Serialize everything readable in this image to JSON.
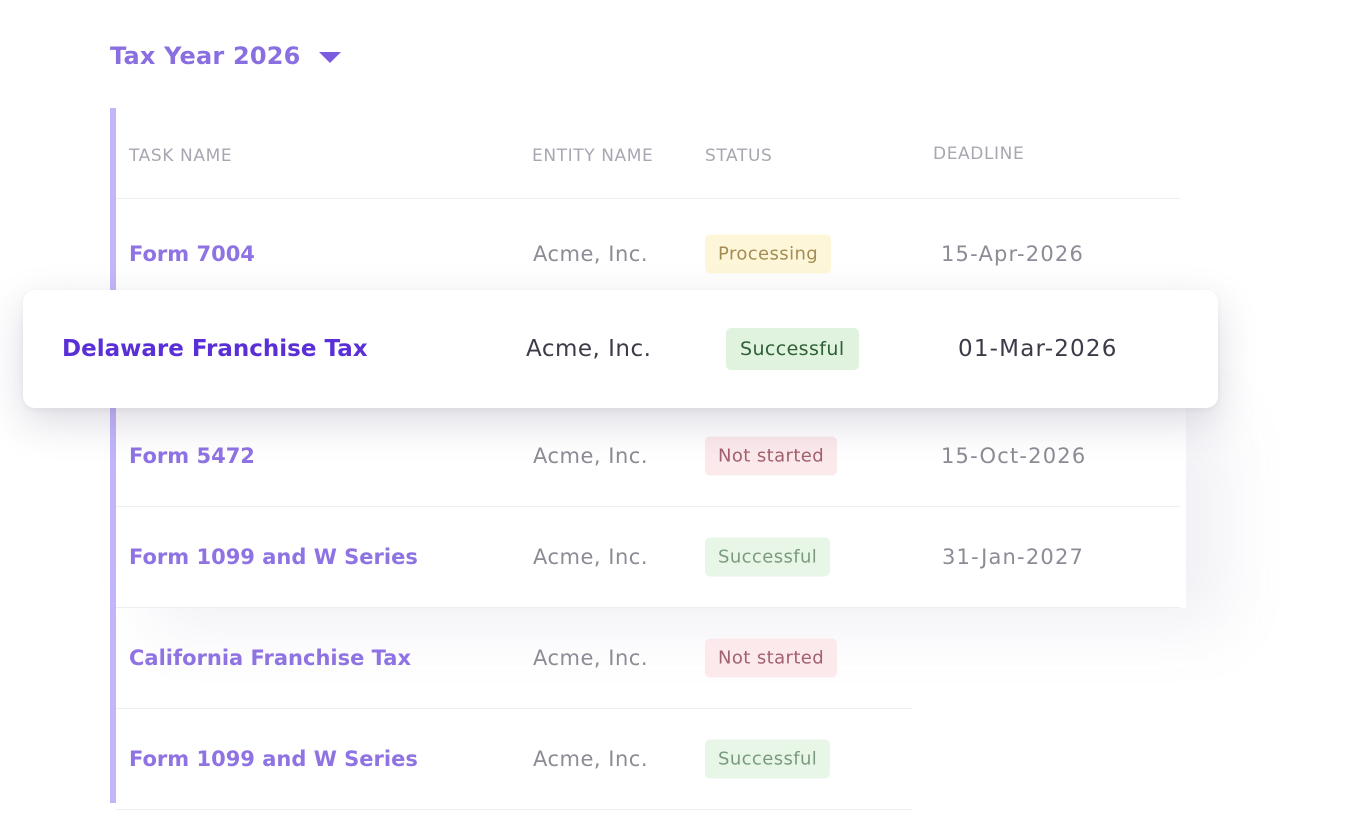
{
  "year_selector": {
    "label": "Tax Year 2026",
    "icon": "caret-down-icon"
  },
  "table": {
    "columns": [
      "TASK NAME",
      "ENTITY NAME",
      "STATUS",
      "DEADLINE"
    ],
    "rows": [
      {
        "task": "Form 7004",
        "entity": "Acme, Inc.",
        "status": "Processing",
        "deadline": "15-Apr-2026"
      },
      {
        "task": "Form 5472",
        "entity": "Acme, Inc.",
        "status": "Not started",
        "deadline": "15-Oct-2026"
      },
      {
        "task": "Form 1099 and W Series",
        "entity": "Acme, Inc.",
        "status": "Successful",
        "deadline": "31-Jan-2027"
      },
      {
        "task": "California Franchise Tax",
        "entity": "Acme, Inc.",
        "status": "Not started",
        "deadline": ""
      },
      {
        "task": "Form 1099 and W Series",
        "entity": "Acme, Inc.",
        "status": "Successful",
        "deadline": ""
      }
    ]
  },
  "highlighted_row": {
    "task": "Delaware Franchise Tax",
    "entity": "Acme, Inc.",
    "status": "Successful",
    "deadline": "01-Mar-2026"
  },
  "colors": {
    "accent": "#7b5ce0",
    "accent_bar": "#c4b5fb",
    "processing_bg": "#fdf6d8",
    "successful_bg": "#e7f6e7",
    "not_started_bg": "#fbe9ec"
  }
}
